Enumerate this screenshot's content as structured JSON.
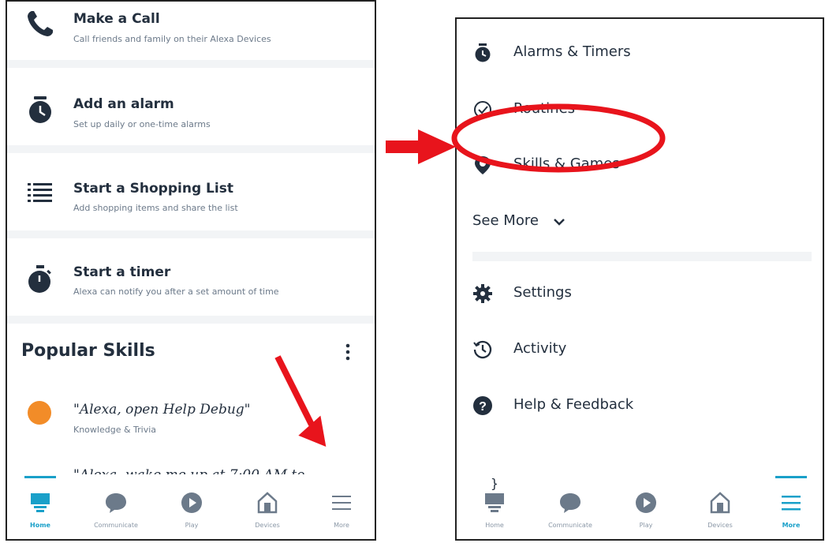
{
  "left_screen": {
    "cards": [
      {
        "title": "Make a Call",
        "subtitle": "Call friends and family on their Alexa Devices",
        "icon": "phone-icon"
      },
      {
        "title": "Add an alarm",
        "subtitle": "Set up daily or one-time alarms",
        "icon": "alarm-clock-icon"
      },
      {
        "title": "Start a Shopping List",
        "subtitle": "Add shopping items and share the list",
        "icon": "list-icon"
      },
      {
        "title": "Start a timer",
        "subtitle": "Alexa can notify you after a set amount of time",
        "icon": "stopwatch-icon"
      }
    ],
    "popular_skills": {
      "title": "Popular Skills",
      "skill": {
        "phrase": "\"Alexa, open Help Debug\"",
        "category": "Knowledge & Trivia"
      },
      "next_skill_partial": "\"Alexa, wake me up at 7:00 AM to"
    },
    "bottom_nav": {
      "items": [
        {
          "label": "Home",
          "icon": "home-icon"
        },
        {
          "label": "Communicate",
          "icon": "chat-bubble-icon"
        },
        {
          "label": "Play",
          "icon": "play-icon"
        },
        {
          "label": "Devices",
          "icon": "devices-icon"
        },
        {
          "label": "More",
          "icon": "hamburger-menu-icon"
        }
      ],
      "active": "Home"
    }
  },
  "right_screen": {
    "menu_top": [
      {
        "label": "Alarms & Timers",
        "icon": "alarm-clock-icon"
      },
      {
        "label": "Routines",
        "icon": "routine-check-icon"
      },
      {
        "label": "Skills & Games",
        "icon": "location-pin-icon"
      }
    ],
    "see_more": "See More",
    "menu_bottom": [
      {
        "label": "Settings",
        "icon": "gear-icon"
      },
      {
        "label": "Activity",
        "icon": "history-icon"
      },
      {
        "label": "Help & Feedback",
        "icon": "help-icon"
      }
    ],
    "bottom_nav": {
      "items": [
        {
          "label": "Home",
          "icon": "home-icon"
        },
        {
          "label": "Communicate",
          "icon": "chat-bubble-icon"
        },
        {
          "label": "Play",
          "icon": "play-icon"
        },
        {
          "label": "Devices",
          "icon": "devices-icon"
        },
        {
          "label": "More",
          "icon": "hamburger-menu-icon"
        }
      ],
      "active": "More"
    }
  },
  "colors": {
    "accent": "#1aa0c9",
    "annotation": "#e8141c",
    "skill_icon": "#f28c28",
    "text": "#232f3e"
  }
}
